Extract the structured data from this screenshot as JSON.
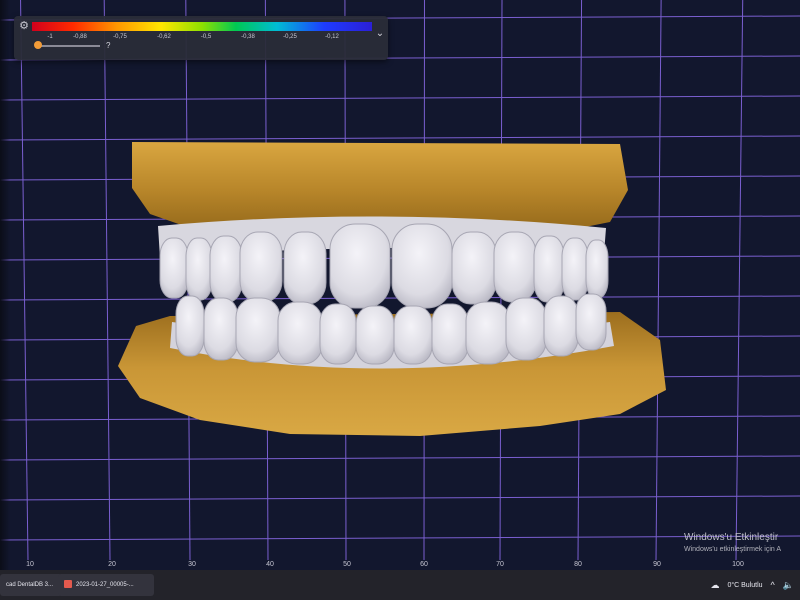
{
  "color_scale": {
    "ticks": [
      "-1",
      "-0,88",
      "-0,75",
      "-0,62",
      "-0,5",
      "-0,38",
      "-0,25",
      "-0,12"
    ],
    "help": "?",
    "gradient_colors": [
      "#d1001c",
      "#ff9800",
      "#ffe600",
      "#8ee000",
      "#00c853",
      "#00bcd4",
      "#1e3cff",
      "#2b1fd8"
    ]
  },
  "axis": {
    "labels": [
      "10",
      "20",
      "30",
      "40",
      "50",
      "60",
      "70",
      "80",
      "90",
      "100"
    ]
  },
  "watermark": {
    "title": "Windows'u Etkinleştir",
    "subtitle": "Windows'u etkinleştirmek için A"
  },
  "taskbar": {
    "items": [
      {
        "label": "cad DentalDB 3..."
      },
      {
        "label": "2023-01-27_00005-..."
      }
    ],
    "weather": "0°C  Bulutlu"
  },
  "colors": {
    "background": "#12172e",
    "grid": "#7a5fd0",
    "stone": "#c8922c",
    "teeth": "#e4e3ea"
  }
}
